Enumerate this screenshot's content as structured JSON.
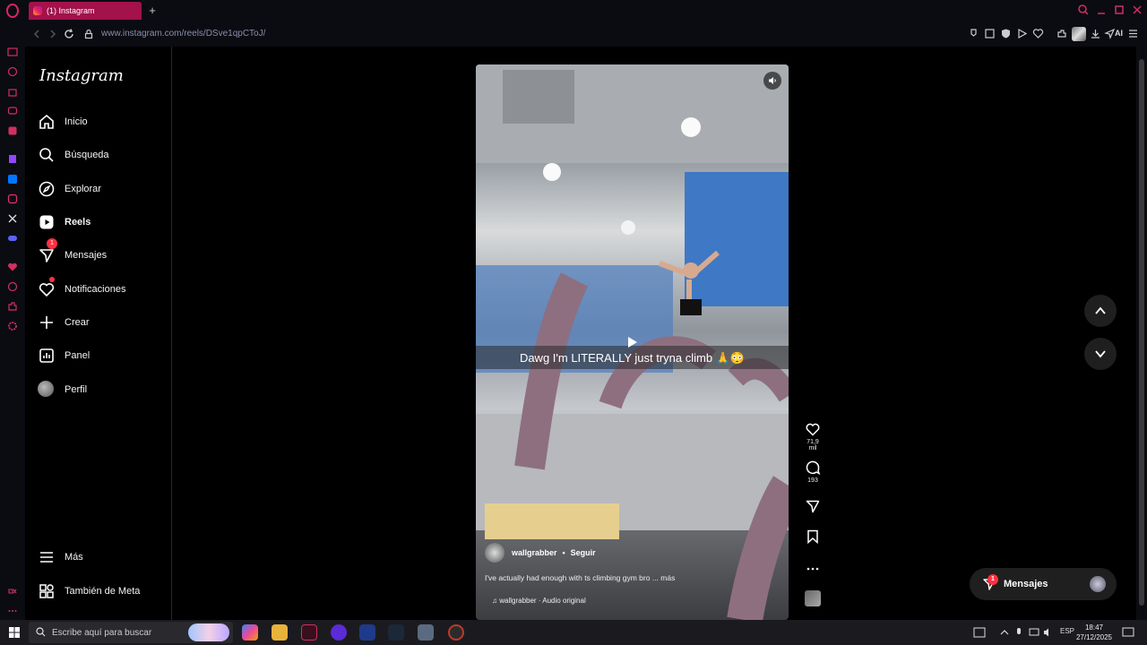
{
  "browser": {
    "tab_title": "(1) Instagram",
    "new_tab": "+",
    "url": "www.instagram.com/reels/DSve1qpCToJ/",
    "ai_label": "AI"
  },
  "sidebar": {
    "logo": "Instagram",
    "items": [
      {
        "label": "Inicio",
        "icon": "home-icon"
      },
      {
        "label": "Búsqueda",
        "icon": "search-icon"
      },
      {
        "label": "Explorar",
        "icon": "compass-icon"
      },
      {
        "label": "Reels",
        "icon": "reels-icon"
      },
      {
        "label": "Mensajes",
        "icon": "messages-icon",
        "badge": "1"
      },
      {
        "label": "Notificaciones",
        "icon": "heart-icon"
      },
      {
        "label": "Crear",
        "icon": "plus-icon"
      },
      {
        "label": "Panel",
        "icon": "dashboard-icon"
      },
      {
        "label": "Perfil",
        "icon": "avatar"
      }
    ],
    "more": "Más",
    "meta": "También de Meta"
  },
  "reel": {
    "caption": "Dawg I'm LITERALLY just tryna climb 🙏😳",
    "username": "wallgrabber",
    "follow": "Seguir",
    "separator": "•",
    "description": "I've actually had enough with ts climbing gym bro ... más",
    "audio": "wallgrabber · Audio original",
    "likes": "71,9 mil",
    "comments": "193"
  },
  "messages_pill": {
    "label": "Mensajes",
    "badge": "1"
  },
  "taskbar": {
    "search_placeholder": "Escribe aquí para buscar",
    "lang": "ESP",
    "time": "18:47",
    "date": "27/12/2025"
  },
  "colors": {
    "accent": "#a3124a",
    "badge": "#ff3040",
    "bg": "#000000"
  }
}
